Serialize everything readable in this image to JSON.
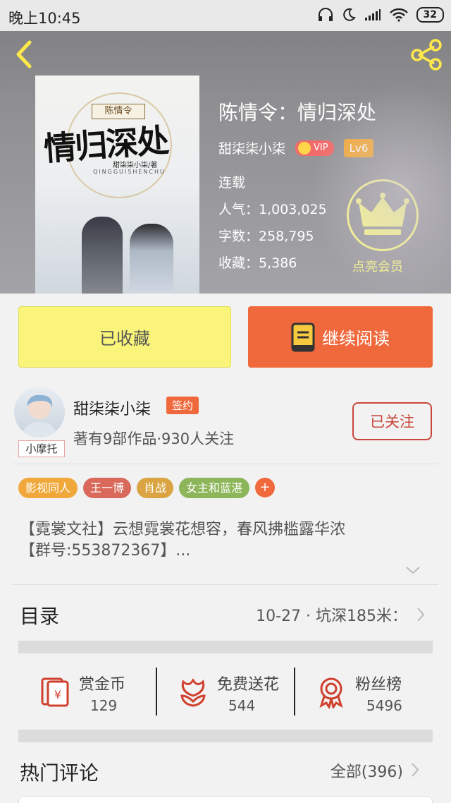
{
  "status_bar": {
    "time": "晚上10:45",
    "battery": "32"
  },
  "book": {
    "title": "陈情令：情归深处",
    "author": "甜柒柒小柒",
    "vip_label": "VIP",
    "level": "Lv6",
    "status": "连载",
    "popularity": "人气：1,003,025",
    "word_count": "字数：258,795",
    "favorites": "收藏：5,386",
    "member_label": "点亮会员",
    "cover": {
      "series": "陈情令",
      "title": "情归深处",
      "author": "甜柒柒小柒/著",
      "pinyin": "QINGGUISHENCHU"
    }
  },
  "buttons": {
    "collected": "已收藏",
    "continue_reading": "继续阅读"
  },
  "author_card": {
    "name": "甜柒柒小柒",
    "sign_badge": "签约",
    "info": "著有9部作品·930人关注",
    "follow": "已关注",
    "avatar_tag": "小摩托"
  },
  "tags": [
    {
      "label": "影视同人",
      "color": "#f0a83a"
    },
    {
      "label": "王一博",
      "color": "#d9695a"
    },
    {
      "label": "肖战",
      "color": "#d9a441"
    },
    {
      "label": "女主和蓝湛",
      "color": "#8db65a"
    }
  ],
  "tag_more": "+",
  "description": {
    "line1": "【霓裳文社】云想霓裳花想容，春风拂槛露华浓",
    "line2": "【群号:553872367】..."
  },
  "toc": {
    "label": "目录",
    "latest": "10-27 · 坑深185米："
  },
  "actions": [
    {
      "label": "赏金币",
      "value": "129",
      "icon": "coin-reward-icon"
    },
    {
      "label": "免费送花",
      "value": "544",
      "icon": "flower-icon"
    },
    {
      "label": "粉丝榜",
      "value": "5496",
      "icon": "medal-icon"
    }
  ],
  "comments": {
    "label": "热门评论",
    "all": "全部(396)"
  },
  "colors": {
    "accent": "#f0693c",
    "collected_bg": "#faf47a",
    "member_yellow": "#f5f28e"
  }
}
